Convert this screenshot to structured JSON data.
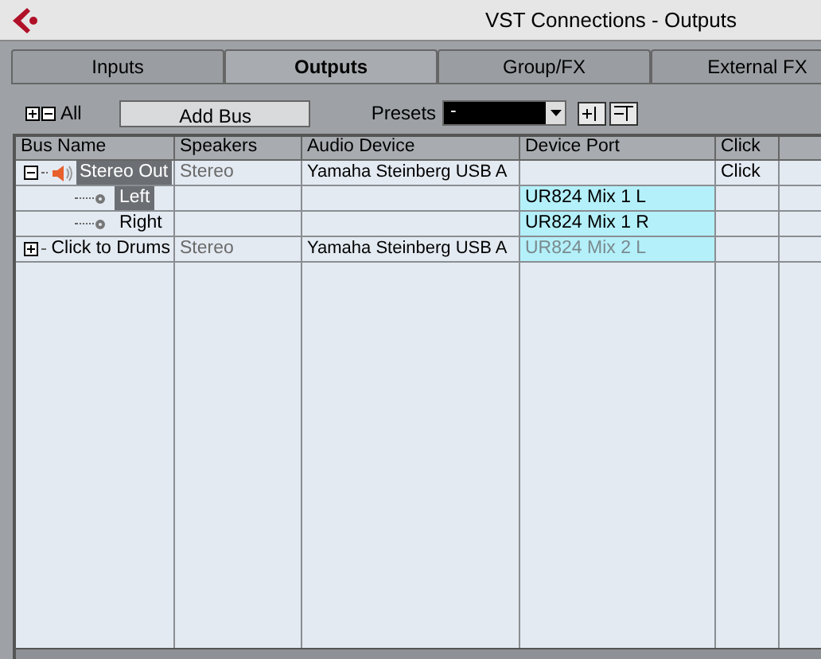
{
  "window": {
    "title": "VST Connections - Outputs"
  },
  "tabs": [
    {
      "label": "Inputs",
      "selected": false
    },
    {
      "label": "Outputs",
      "selected": true
    },
    {
      "label": "Group/FX",
      "selected": false
    },
    {
      "label": "External FX",
      "selected": false
    }
  ],
  "toolbar": {
    "all_label": "All",
    "add_bus": "Add Bus",
    "presets_label": "Presets",
    "preset_value": "-"
  },
  "table": {
    "columns": [
      "Bus Name",
      "Speakers",
      "Audio Device",
      "Device Port",
      "Click"
    ],
    "rows": [
      {
        "name": "Stereo Out",
        "selected": true,
        "expanded": true,
        "speakers": "Stereo",
        "audio_device": "Yamaha Steinberg USB A",
        "device_port": "",
        "click": "Click",
        "children": [
          {
            "name": "Left",
            "selected": true,
            "device_port": "UR824 Mix 1 L",
            "port_dimmed": false
          },
          {
            "name": "Right",
            "selected": false,
            "device_port": "UR824 Mix 1 R",
            "port_dimmed": false
          }
        ]
      },
      {
        "name": "Click to Drums",
        "selected": false,
        "expanded": false,
        "speakers": "Stereo",
        "audio_device": "Yamaha Steinberg USB A",
        "device_port": "UR824 Mix 2 L",
        "port_dimmed": true,
        "click": ""
      }
    ]
  }
}
